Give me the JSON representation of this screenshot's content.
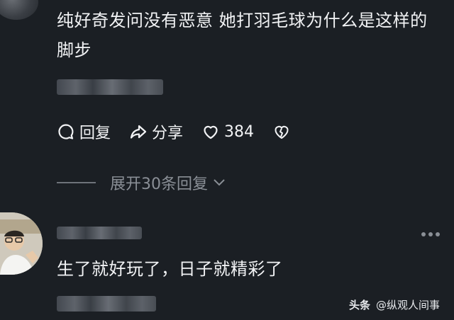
{
  "comment": {
    "text": "纯好奇发问没有恶意 她打羽毛球为什么是这样的脚步",
    "actions": {
      "reply_label": "回复",
      "share_label": "分享",
      "like_count": "384"
    },
    "expand_label": "展开30条回复"
  },
  "reply": {
    "text": "生了就好玩了，日子就精彩了"
  },
  "watermark": {
    "brand": "头条",
    "account": "@纵观人间事"
  },
  "icons": [
    "comment-icon",
    "share-icon",
    "heart-icon",
    "dislike-icon",
    "chevron-down-icon",
    "more-icon"
  ],
  "colors": {
    "background": "#1b1f24",
    "text": "#f2f3f5",
    "muted": "#8a8f96"
  }
}
